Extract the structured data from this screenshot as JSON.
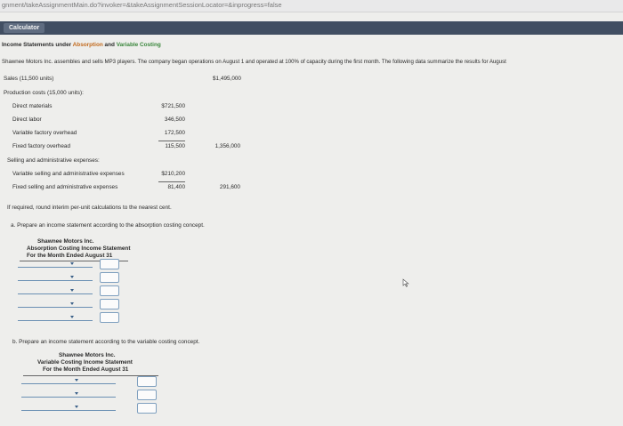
{
  "browser": {
    "url": "gnment/takeAssignmentMain.do?invoker=&takeAssignmentSessionLocator=&inprogress=false"
  },
  "toolbar": {
    "calculator_label": "Calculator"
  },
  "problem": {
    "title_pre": "Income Statements under ",
    "title_absorption": "Absorption",
    "title_mid": " and ",
    "title_variable": "Variable Costing",
    "intro": "Shawnee Motors Inc. assembles and sells MP3 players. The company began operations on August 1 and operated at 100% of capacity during the first month. The following data summarize the results for August",
    "sales_label": "Sales (11,500 units)",
    "sales_value": "$1,495,000",
    "production_label": "Production costs (15,000 units):",
    "direct_materials_label": "Direct materials",
    "direct_materials_value": "$721,500",
    "direct_labor_label": "Direct labor",
    "direct_labor_value": "346,500",
    "variable_overhead_label": "Variable factory overhead",
    "variable_overhead_value": "172,500",
    "fixed_overhead_label": "Fixed factory overhead",
    "fixed_overhead_value": "115,500",
    "production_total": "1,356,000",
    "selling_label": "Selling and administrative expenses:",
    "variable_selling_label": "Variable selling and administrative expenses",
    "variable_selling_value": "$210,200",
    "fixed_selling_label": "Fixed selling and administrative expenses",
    "fixed_selling_value": "81,400",
    "selling_total": "291,600",
    "rounding_note": "If required, round interim per-unit calculations to the nearest cent."
  },
  "part_a": {
    "instruction": "a.  Prepare an income statement according to the absorption costing concept.",
    "company": "Shawnee Motors Inc.",
    "statement_title": "Absorption Costing Income Statement",
    "period": "For the Month Ended August 31"
  },
  "part_b": {
    "instruction": "b.  Prepare an income statement according to the variable costing concept.",
    "company": "Shawnee Motors Inc.",
    "statement_title": "Variable Costing Income Statement",
    "period": "For the Month Ended August 31"
  },
  "colors": {
    "orange_keyword": "#c26a1d",
    "green_keyword": "#39863b",
    "calculator_bar": "#414e62",
    "dropdown_line": "#6a8fb3"
  },
  "icons": {
    "dropdown": "chevron-down-icon",
    "cursor": "arrow-cursor-icon"
  }
}
